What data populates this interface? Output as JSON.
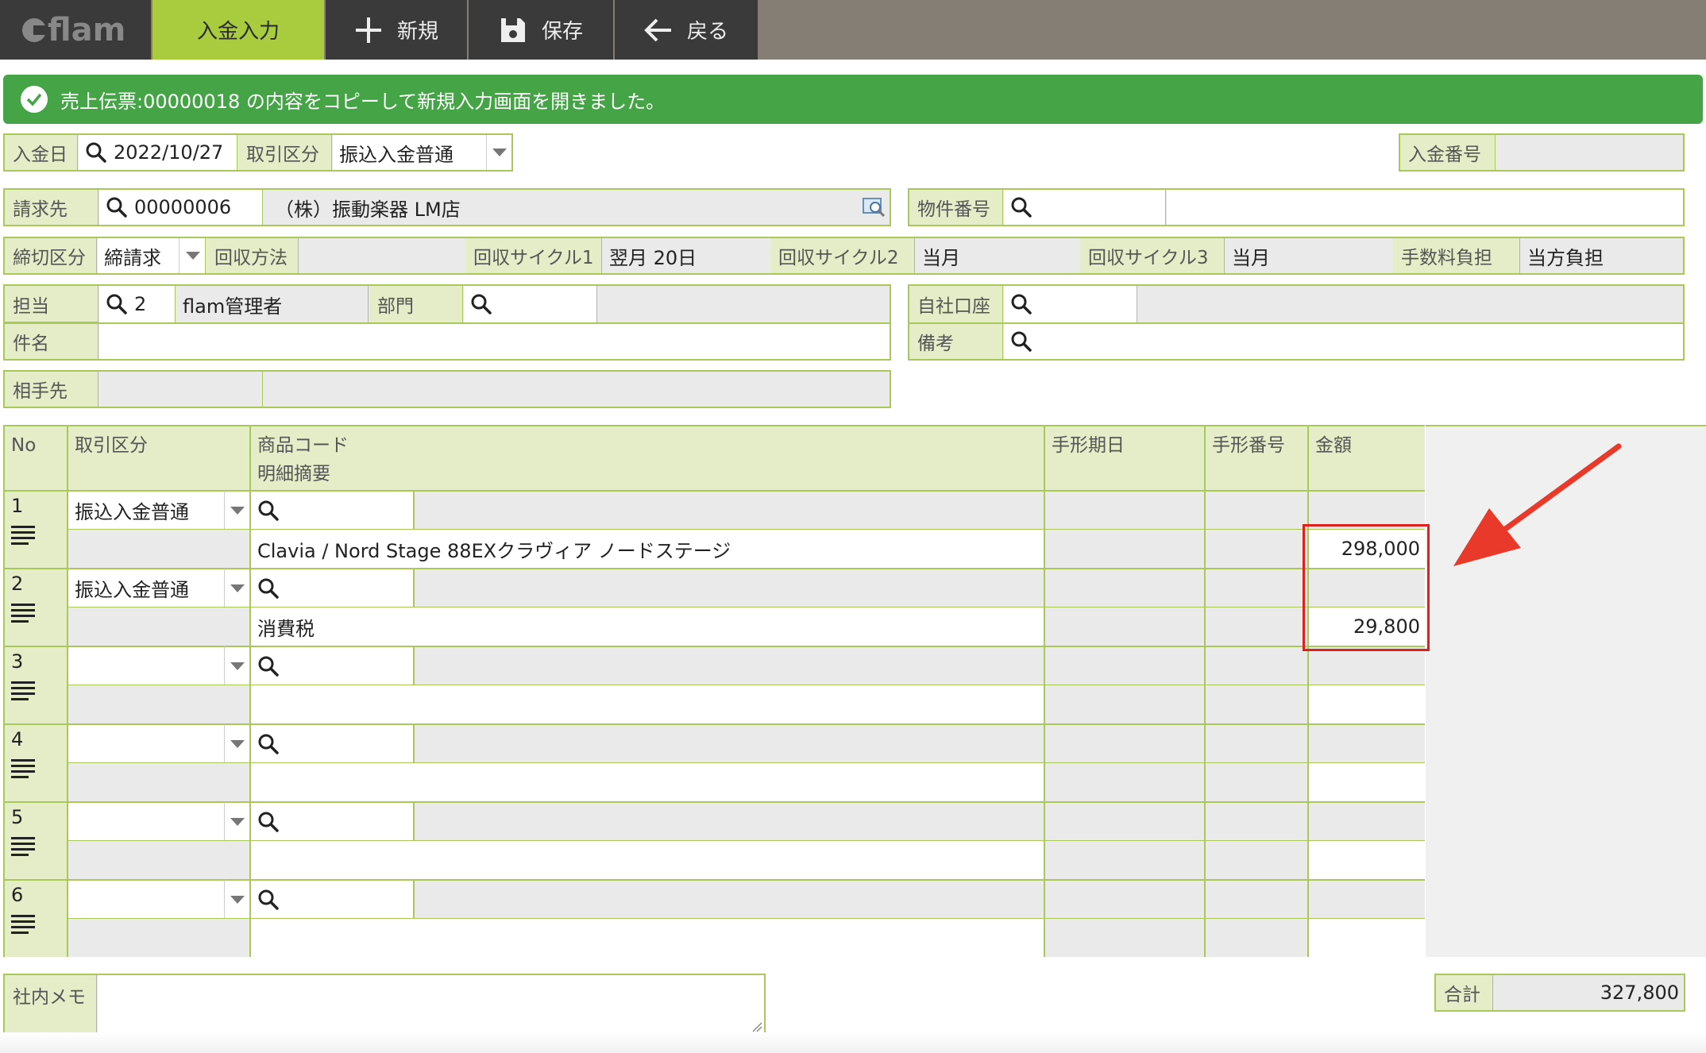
{
  "app": {
    "logo": "flam"
  },
  "nav": {
    "active": "入金入力",
    "new": "新規",
    "save": "保存",
    "back": "戻る"
  },
  "banner": {
    "message": "売上伝票:00000018 の内容をコピーして新規入力画面を開きました。"
  },
  "header": {
    "payment_date_label": "入金日",
    "payment_date": "2022/10/27",
    "trade_type_label": "取引区分",
    "trade_type": "振込入金普通",
    "payment_no_label": "入金番号",
    "payment_no": "",
    "billing_label": "請求先",
    "billing_code": "00000006",
    "billing_name": "（株）振動楽器 LM店",
    "property_no_label": "物件番号",
    "closing_type_label": "締切区分",
    "closing_type": "締請求",
    "collect_method_label": "回収方法",
    "collect_method": "",
    "cycle1_label": "回収サイクル1",
    "cycle1": "翌月 20日",
    "cycle2_label": "回収サイクル2",
    "cycle2": "当月",
    "cycle3_label": "回収サイクル3",
    "cycle3": "当月",
    "fee_label": "手数料負担",
    "fee": "当方負担",
    "staff_label": "担当",
    "staff_code": "2",
    "staff_name": "flam管理者",
    "dept_label": "部門",
    "own_account_label": "自社口座",
    "subject_label": "件名",
    "remarks_label": "備考",
    "counterpart_label": "相手先"
  },
  "table": {
    "headers": {
      "no": "No",
      "trade_type": "取引区分",
      "product_code": "商品コード",
      "summary": "明細摘要",
      "note_date": "手形期日",
      "note_no": "手形番号",
      "amount": "金額"
    },
    "rows": [
      {
        "no": "1",
        "trade_type": "振込入金普通",
        "summary": "Clavia / Nord Stage 88EXクラヴィア ノードステージ",
        "amount": "298,000"
      },
      {
        "no": "2",
        "trade_type": "振込入金普通",
        "summary": "消費税",
        "amount": "29,800"
      },
      {
        "no": "3",
        "trade_type": "",
        "summary": "",
        "amount": ""
      },
      {
        "no": "4",
        "trade_type": "",
        "summary": "",
        "amount": ""
      },
      {
        "no": "5",
        "trade_type": "",
        "summary": "",
        "amount": ""
      },
      {
        "no": "6",
        "trade_type": "",
        "summary": "",
        "amount": ""
      }
    ]
  },
  "footer": {
    "memo_label": "社内メモ",
    "total_label": "合計",
    "total": "327,800"
  },
  "colors": {
    "accent": "#a8cc3e",
    "banner": "#44a446",
    "border": "#aac85a",
    "highlight": "#e02020"
  }
}
